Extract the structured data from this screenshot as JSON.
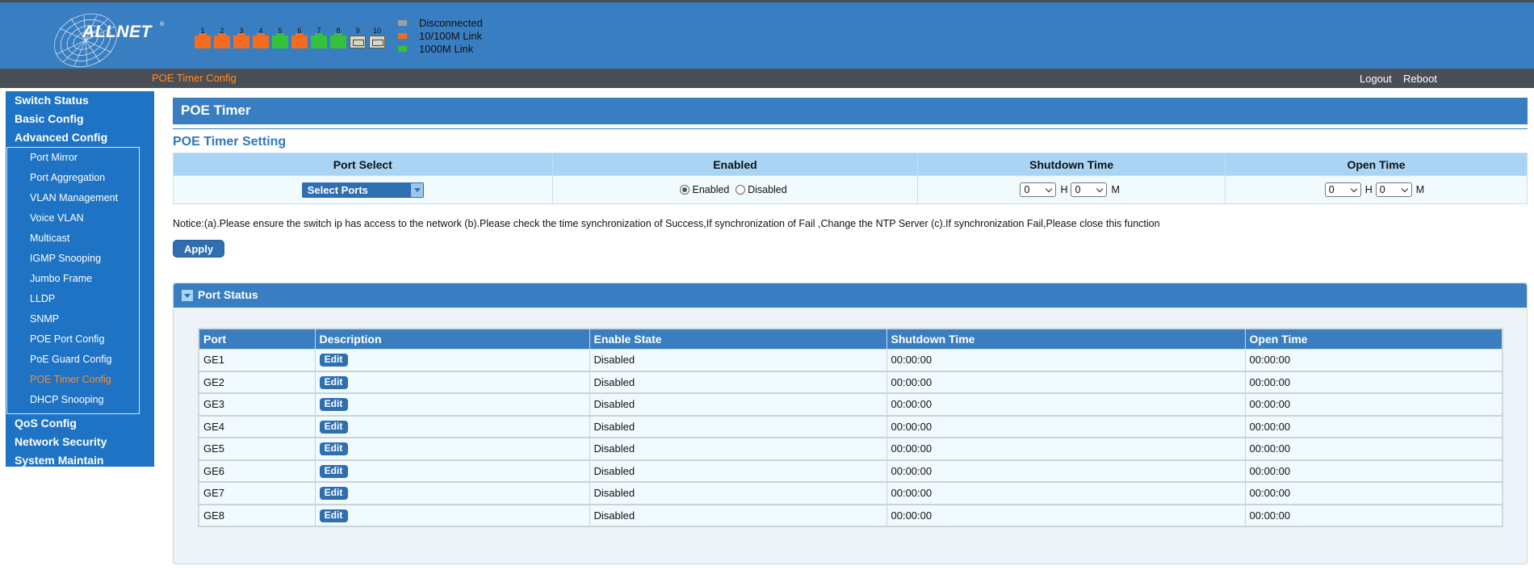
{
  "header": {
    "logo_text": "ALLNET",
    "logo_mark": "®",
    "ports": [
      {
        "num": "1",
        "status": "10/100M Link",
        "color": "#f36c21"
      },
      {
        "num": "2",
        "status": "10/100M Link",
        "color": "#f36c21"
      },
      {
        "num": "3",
        "status": "10/100M Link",
        "color": "#f36c21"
      },
      {
        "num": "4",
        "status": "10/100M Link",
        "color": "#f36c21"
      },
      {
        "num": "5",
        "status": "1000M Link",
        "color": "#33c23a"
      },
      {
        "num": "6",
        "status": "10/100M Link",
        "color": "#f36c21"
      },
      {
        "num": "7",
        "status": "1000M Link",
        "color": "#33c23a"
      },
      {
        "num": "8",
        "status": "1000M Link",
        "color": "#33c23a"
      },
      {
        "num": "9",
        "status": "Disconnected",
        "type": "sfp"
      },
      {
        "num": "10",
        "status": "Disconnected",
        "type": "sfp"
      }
    ],
    "legend": [
      {
        "label": "Disconnected",
        "color": "#9aa0a4"
      },
      {
        "label": "10/100M Link",
        "color": "#f36c21"
      },
      {
        "label": "1000M Link",
        "color": "#33c23a"
      }
    ]
  },
  "navbar": {
    "breadcrumb": "POE Timer Config",
    "logout": "Logout",
    "reboot": "Reboot"
  },
  "sidebar": {
    "top_items": [
      "Switch Status",
      "Basic Config",
      "Advanced Config"
    ],
    "sub_items": [
      "Port Mirror",
      "Port Aggregation",
      "VLAN Management",
      "Voice VLAN",
      "Multicast",
      "IGMP Snooping",
      "Jumbo Frame",
      "LLDP",
      "SNMP",
      "POE Port Config",
      "PoE Guard Config",
      "POE Timer Config",
      "DHCP Snooping"
    ],
    "active_sub": "POE Timer Config",
    "bottom_items": [
      "QoS Config",
      "Network Security",
      "System Maintain"
    ]
  },
  "main": {
    "title": "POE Timer",
    "section_title": "POE Timer Setting",
    "setting_headers": [
      "Port Select",
      "Enabled",
      "Shutdown Time",
      "Open Time"
    ],
    "select_ports_label": "Select Ports",
    "enabled_label": "Enabled",
    "disabled_label": "Disabled",
    "enabled_selected": "Enabled",
    "shutdown_hour": "0",
    "shutdown_min": "0",
    "open_hour": "0",
    "open_min": "0",
    "hour_unit": "H",
    "min_unit": "M",
    "notice": "Notice:(a).Please ensure the switch ip has access to the network (b).Please check the time synchronization of Success,If synchronization of Fail ,Change the NTP Server (c).If synchronization Fail,Please close this function",
    "apply_label": "Apply"
  },
  "port_status": {
    "title": "Port Status",
    "columns": [
      "Port",
      "Description",
      "Enable State",
      "Shutdown Time",
      "Open Time"
    ],
    "edit_label": "Edit",
    "rows": [
      {
        "port": "GE1",
        "state": "Disabled",
        "shutdown": "00:00:00",
        "open": "00:00:00"
      },
      {
        "port": "GE2",
        "state": "Disabled",
        "shutdown": "00:00:00",
        "open": "00:00:00"
      },
      {
        "port": "GE3",
        "state": "Disabled",
        "shutdown": "00:00:00",
        "open": "00:00:00"
      },
      {
        "port": "GE4",
        "state": "Disabled",
        "shutdown": "00:00:00",
        "open": "00:00:00"
      },
      {
        "port": "GE5",
        "state": "Disabled",
        "shutdown": "00:00:00",
        "open": "00:00:00"
      },
      {
        "port": "GE6",
        "state": "Disabled",
        "shutdown": "00:00:00",
        "open": "00:00:00"
      },
      {
        "port": "GE7",
        "state": "Disabled",
        "shutdown": "00:00:00",
        "open": "00:00:00"
      },
      {
        "port": "GE8",
        "state": "Disabled",
        "shutdown": "00:00:00",
        "open": "00:00:00"
      }
    ]
  }
}
